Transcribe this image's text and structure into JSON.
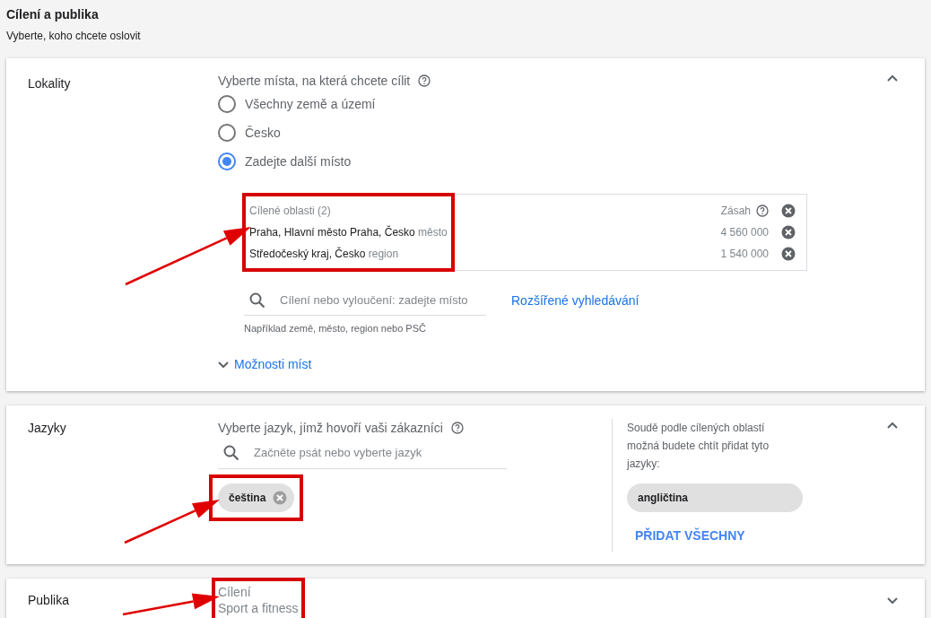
{
  "header": {
    "title": "Cílení a publika",
    "subtitle": "Vyberte, koho chcete oslovit"
  },
  "locations": {
    "label": "Lokality",
    "expanded": true,
    "prompt": "Vyberte místa, na která chcete cílit",
    "options": [
      {
        "label": "Všechny země a území",
        "selected": false
      },
      {
        "label": "Česko",
        "selected": false
      },
      {
        "label": "Zadejte další místo",
        "selected": true
      }
    ],
    "targeted": {
      "heading": "Cílené oblasti (2)",
      "reach_label": "Zásah",
      "highlighted": true,
      "rows": [
        {
          "name": "Praha, Hlavní město Praha, Česko",
          "type": "město",
          "reach": "4 560 000"
        },
        {
          "name": "Středočeský kraj, Česko",
          "type": "region",
          "reach": "1 540 000"
        }
      ]
    },
    "search": {
      "placeholder": "Cílení nebo vyloučení: zadejte místo",
      "hint": "Například země, město, region nebo PSČ"
    },
    "advanced_link": "Rozšířené vyhledávání",
    "more_options": "Možnosti míst"
  },
  "languages": {
    "label": "Jazyky",
    "expanded": true,
    "prompt": "Vyberte jazyk, jímž hovoří vaši zákazníci",
    "search": {
      "placeholder": "Začněte psát nebo vyberte jazyk"
    },
    "highlighted": true,
    "chips": [
      {
        "label": "čeština"
      }
    ],
    "suggestion": {
      "text": "Soudě podle cílených oblastí možná budete chtít přidat tyto jazyky:",
      "chips": [
        {
          "label": "angličtina"
        }
      ],
      "add_all": "PŘIDAT VŠECHNY"
    }
  },
  "audiences": {
    "label": "Publika",
    "expanded": false,
    "highlighted": true,
    "lines": [
      "Cílení",
      "Sport a fitness"
    ]
  }
}
